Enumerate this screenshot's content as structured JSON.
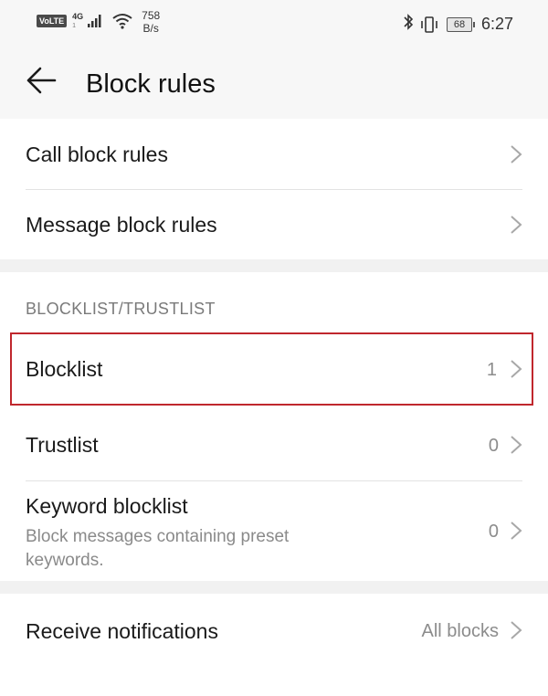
{
  "status_bar": {
    "volte_badge": "VoLTE",
    "network_type": "4G",
    "network_sub": "1",
    "speed_value": "758",
    "speed_unit": "B/s",
    "battery_level": "68",
    "time": "6:27",
    "icons": [
      "signal-icon",
      "wifi-icon",
      "bluetooth-icon",
      "vibrate-icon",
      "battery-icon"
    ]
  },
  "header": {
    "title": "Block rules",
    "back_icon": "arrow-left-icon"
  },
  "rules_group": {
    "items": [
      {
        "label": "Call block rules"
      },
      {
        "label": "Message block rules"
      }
    ]
  },
  "lists_group": {
    "section_title": "BLOCKLIST/TRUSTLIST",
    "items": [
      {
        "label": "Blocklist",
        "value": "1",
        "highlighted": true
      },
      {
        "label": "Trustlist",
        "value": "0"
      },
      {
        "label": "Keyword blocklist",
        "sublabel": "Block messages containing preset keywords.",
        "value": "0"
      }
    ]
  },
  "notifications_group": {
    "items": [
      {
        "label": "Receive notifications",
        "value": "All blocks"
      }
    ]
  },
  "colors": {
    "highlight_border": "#c0272d",
    "background": "#f7f7f7",
    "divider": "#e3e3e3"
  }
}
